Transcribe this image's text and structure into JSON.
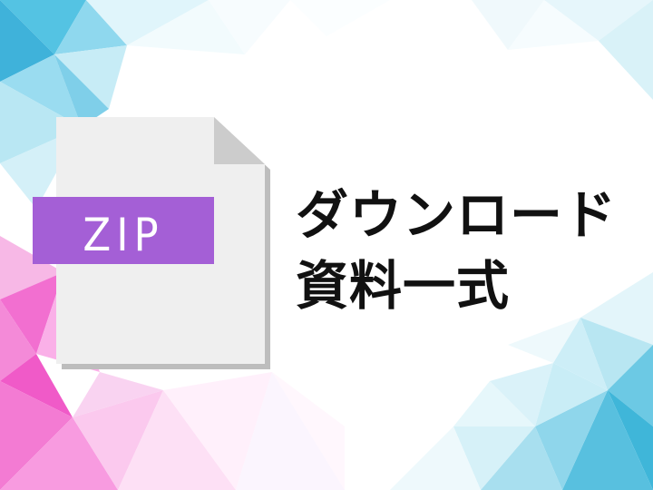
{
  "file_badge": {
    "label": "ZIP",
    "badge_color": "#a45fd6",
    "page_color": "#efefef",
    "fold_color": "#cccccc",
    "shadow_color": "#bdbdbd",
    "icon": "zip-file-icon"
  },
  "headline": {
    "line1": "ダウンロード",
    "line2": "資料一式"
  },
  "background": {
    "style": "low-poly",
    "colors": [
      "#3fb6d9",
      "#f05ac8",
      "#ffffff"
    ]
  }
}
